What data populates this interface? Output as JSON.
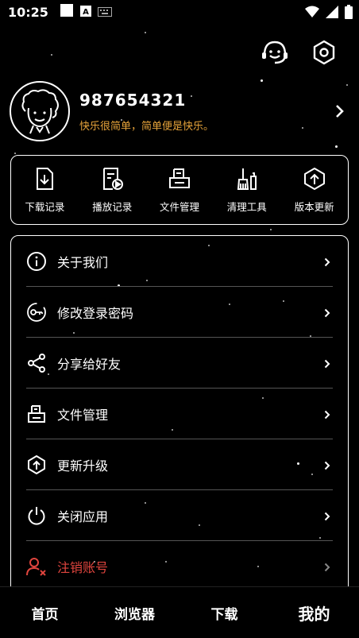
{
  "status_bar": {
    "time": "10:25"
  },
  "header": {
    "support_icon": "headset-face-icon",
    "settings_icon": "hex-gear-icon"
  },
  "profile": {
    "username": "987654321",
    "motto": "快乐很简单，简单便是快乐。"
  },
  "tools": [
    {
      "label": "下载记录",
      "icon": "download-doc-icon"
    },
    {
      "label": "播放记录",
      "icon": "play-history-icon"
    },
    {
      "label": "文件管理",
      "icon": "file-manager-icon"
    },
    {
      "label": "清理工具",
      "icon": "broom-icon"
    },
    {
      "label": "版本更新",
      "icon": "update-icon"
    }
  ],
  "menu": [
    {
      "label": "关于我们",
      "icon": "info-icon"
    },
    {
      "label": "修改登录密码",
      "icon": "key-icon"
    },
    {
      "label": "分享给好友",
      "icon": "share-icon"
    },
    {
      "label": "文件管理",
      "icon": "folder-doc-icon"
    },
    {
      "label": "更新升级",
      "icon": "upgrade-icon"
    },
    {
      "label": "关闭应用",
      "icon": "power-icon"
    },
    {
      "label": "注销账号",
      "icon": "user-remove-icon"
    }
  ],
  "bottom_nav": [
    {
      "label": "首页"
    },
    {
      "label": "浏览器"
    },
    {
      "label": "下载"
    },
    {
      "label": "我的"
    }
  ],
  "colors": {
    "accent": "#e6a33a",
    "danger": "#e0453e",
    "background": "#000000"
  }
}
